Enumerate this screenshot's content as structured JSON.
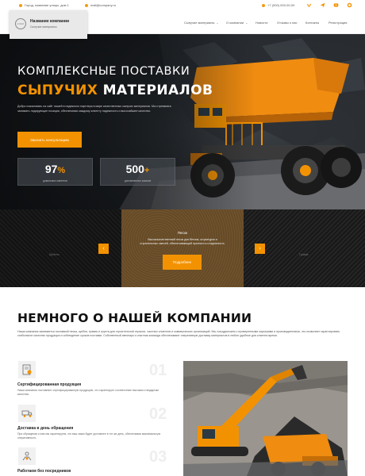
{
  "topbar": {
    "address": "Город, название улицы, дом 1",
    "email": "mail@company.ru",
    "phone": "+7 (000) 000-00-00"
  },
  "header": {
    "logo_circle": "LOGO",
    "company_name": "Название компании",
    "company_sub": "Сыпучие материалы",
    "nav": [
      {
        "label": "Сыпучие материалы",
        "dropdown": true
      },
      {
        "label": "О компании",
        "dropdown": true
      },
      {
        "label": "Новости",
        "dropdown": false
      },
      {
        "label": "Отзывы о нас",
        "dropdown": false
      },
      {
        "label": "Контакты",
        "dropdown": false
      },
      {
        "label": "Регистрация",
        "dropdown": false
      }
    ]
  },
  "hero": {
    "title_line1": "КОМПЛЕКСНЫЕ ПОСТАВКИ",
    "title_accent": "СЫПУЧИХ",
    "title_rest": "МАТЕРИАЛОВ",
    "description": "Добро пожаловать на сайт нашей в надежного партнера в мире качественных сыпучих материалов. Мы стремимся занимать лидирующие позиции, обеспечивая каждому клиенту надежность и высочайшее качество.",
    "cta_label": "Заказать консультацию",
    "stats": [
      {
        "value": "97",
        "suffix": "%",
        "label": "довольных клиентов"
      },
      {
        "value": "500",
        "suffix": "+",
        "label": "доставленных заказов"
      }
    ]
  },
  "materials": {
    "active_title": "Песок",
    "active_desc": "Высококачественный песок для бетона, штукатурки и строительных смесей, обеспечивающий прочность и надежность.",
    "active_button": "Подробнее",
    "ghost_left": "Щебень",
    "ghost_right": "Гравий",
    "prev_arrow": "‹",
    "next_arrow": "›"
  },
  "about": {
    "title": "НЕМНОГО О НАШЕЙ КОМПАНИИ",
    "text": "Наша компания занимается поставкой песка, щебня, гравия и грунта для строительной отрасли, частных клиентов и коммерческих организаций. Мы сотрудничаем с проверенными карьерами и производителями, что позволяет гарантировать стабильное качество продукции и соблюдение сроков поставки. Собственный автопарк и опытная команда обеспечивают оперативную доставку материалов в любое удобное для клиента время.",
    "features": [
      {
        "icon": "certificate-icon",
        "title": "Сертифицированная продукция",
        "text": "Наша компания поставляет сертифицированную продукцию, что гарантирует соответствие высоким стандартам качества.",
        "num": "01"
      },
      {
        "icon": "truck-icon",
        "title": "Доставка в день обращения",
        "text": "При обращении к нам мы гарантируем, что ваш заказ будет доставлен в тот же день, обеспечивая максимальную оперативность.",
        "num": "02"
      },
      {
        "icon": "handshake-icon",
        "title": "Работаем без посредников",
        "text": "",
        "num": "03"
      }
    ]
  },
  "colors": {
    "accent": "#f39200",
    "dark": "#1b1d20"
  }
}
